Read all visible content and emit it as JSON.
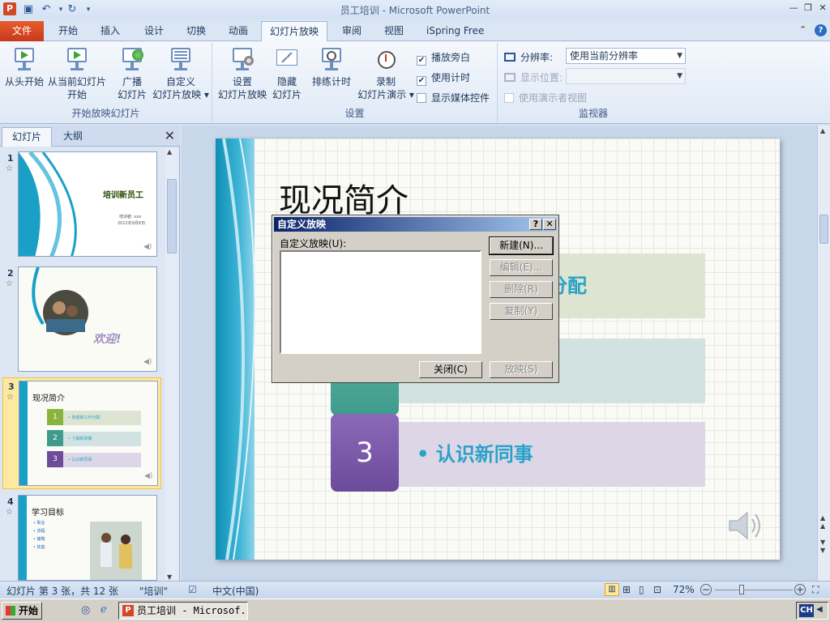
{
  "titlebar": {
    "app_icon": "P",
    "title": "员工培训 - Microsoft PowerPoint",
    "qat": [
      "save-icon",
      "undo-icon",
      "redo-icon",
      "customize-icon"
    ]
  },
  "tabs": [
    {
      "label": "文件"
    },
    {
      "label": "开始"
    },
    {
      "label": "插入"
    },
    {
      "label": "设计"
    },
    {
      "label": "切换"
    },
    {
      "label": "动画"
    },
    {
      "label": "幻灯片放映"
    },
    {
      "label": "审阅"
    },
    {
      "label": "视图"
    },
    {
      "label": "iSpring Free"
    }
  ],
  "ribbon": {
    "group1": {
      "label": "开始放映幻灯片",
      "from_start": [
        "从头开始",
        ""
      ],
      "from_current": [
        "从当前幻灯片",
        "开始"
      ],
      "broadcast": [
        "广播",
        "幻灯片"
      ],
      "custom": [
        "自定义",
        "幻灯片放映 ▾"
      ]
    },
    "group2": {
      "label": "设置",
      "setup": [
        "设置",
        "幻灯片放映"
      ],
      "hide": [
        "隐藏",
        "幻灯片"
      ],
      "rehearse": [
        "排练计时",
        ""
      ],
      "record": [
        "录制",
        "幻灯片演示 ▾"
      ],
      "play_narration": "播放旁白",
      "use_timing": "使用计时",
      "show_media": "显示媒体控件"
    },
    "group3": {
      "label": "监视器",
      "resolution_label": "分辨率:",
      "resolution_value": "使用当前分辨率",
      "display_label": "显示位置:",
      "presenter_view": "使用演示者视图"
    }
  },
  "leftpane": {
    "tab_slides": "幻灯片",
    "tab_outline": "大纲",
    "slides": [
      {
        "num": "1",
        "title": "培训新员工",
        "sub1": "培训者: xxx",
        "sub2": "2012年9月8日"
      },
      {
        "num": "2",
        "title": "欢迎!"
      },
      {
        "num": "3",
        "title": "现况简介",
        "items": [
          "• 熟悉新工作分配",
          "• 了解新政策",
          "• 认识新同事"
        ]
      },
      {
        "num": "4",
        "title": "学习目标",
        "items": [
          "• 职业",
          "• 流程",
          "• 策略",
          "• 技能"
        ]
      }
    ]
  },
  "slide": {
    "title": "现况简介",
    "row1_text": "分配",
    "row3_num": "3",
    "row3_text": "• 认识新同事"
  },
  "dialog": {
    "title": "自定义放映",
    "help": "?",
    "close_x": "✕",
    "list_label": "自定义放映(U):",
    "btn_new": "新建(N)...",
    "btn_edit": "编辑(E)...",
    "btn_delete": "删除(R)",
    "btn_copy": "复制(Y)",
    "btn_close": "关闭(C)",
    "btn_show": "放映(S)"
  },
  "statusbar": {
    "slide_info": "幻灯片 第 3 张，共 12 张",
    "theme": "\"培训\"",
    "language": "中文(中国)",
    "zoom": "72%"
  },
  "taskbar": {
    "start": "开始",
    "window": "员工培训 - Microsof...",
    "ime": "CH"
  },
  "colors": {
    "file_tab": "#d24726",
    "num_green": "#8ab43c",
    "num_teal": "#3f9c8c",
    "num_purple": "#6c4c9a",
    "bar_green": "#dde4d2",
    "bar_teal": "#d2e2e0",
    "bar_purple": "#ddd6e6"
  }
}
